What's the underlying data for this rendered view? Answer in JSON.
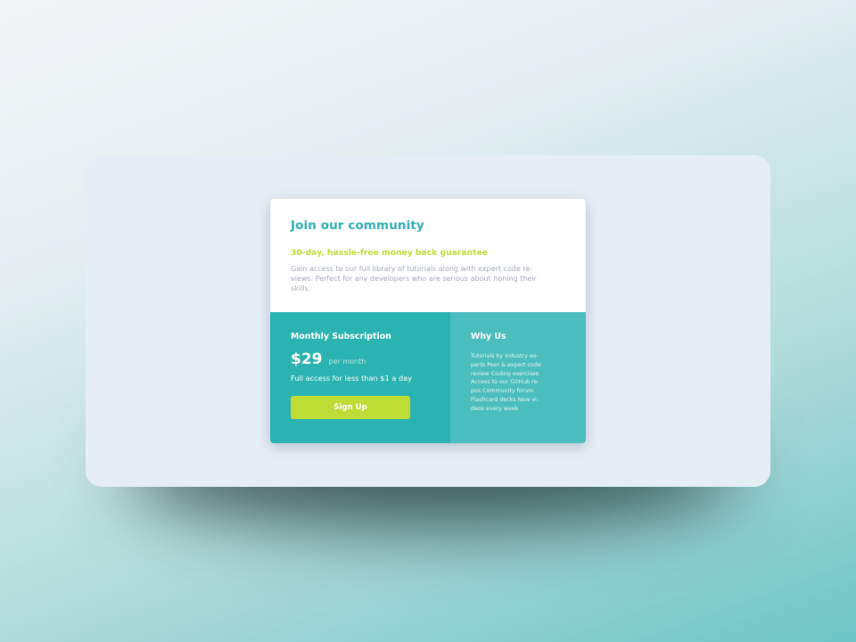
{
  "card": {
    "title": "Join our community",
    "guarantee": "30-day, hassle-free money back guarantee",
    "description": "Gain access to our full library of tutorials along with expert code re-views. Perfect for any developers who are serious about honing their skills."
  },
  "subscription": {
    "title": "Monthly Subscription",
    "price": "$29",
    "period": "per month",
    "tagline": "Full access for less than $1 a day",
    "signup_label": "Sign Up"
  },
  "why_us": {
    "title": "Why Us",
    "text": "Tutorials by industry ex-perts Peer & expert code review Coding exercises Access to our GitHub re-pos Community forum Flashcard decks New vi-deos every week"
  },
  "colors": {
    "accent_teal": "#2bb3b1",
    "accent_teal_light": "#4abebd",
    "accent_lime": "#bfdb35",
    "text_muted": "#a3a9b7"
  }
}
